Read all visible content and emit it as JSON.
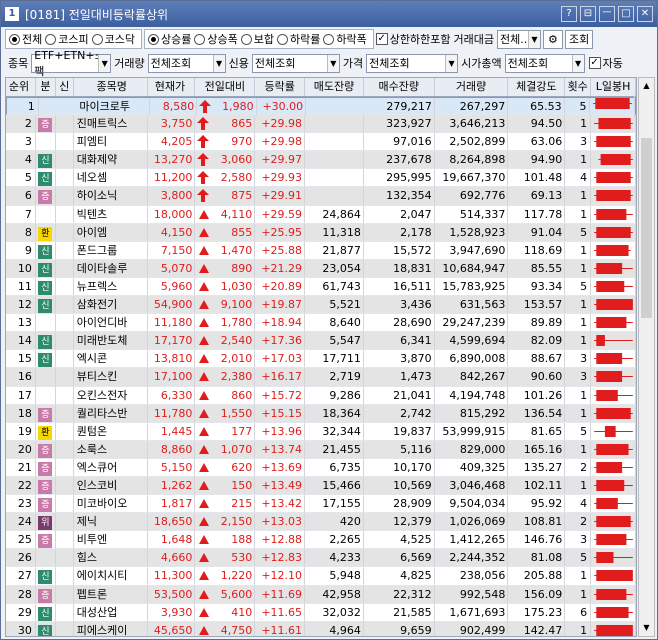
{
  "title": {
    "num": "1",
    "text": "[0181] 전일대비등락률상위"
  },
  "window_buttons": [
    "?",
    "⊟",
    "ㅡ",
    "□",
    "✕"
  ],
  "filters": {
    "market": {
      "options": [
        "전체",
        "코스피",
        "코스닥"
      ],
      "selected": 0
    },
    "type": {
      "options": [
        "상승률",
        "상승폭",
        "보합",
        "하락률",
        "하락폭"
      ],
      "selected": 0
    },
    "upper_limit": {
      "label": "상한하한포함",
      "checked": true
    },
    "amount_label": "거래대금",
    "amount_value": "전체..",
    "search_button": "조회",
    "item_label": "종목",
    "item_value": "ETF+ETN+스팩",
    "volume_label": "거래량",
    "volume_value": "전체조회",
    "credit_label": "신용",
    "credit_value": "전체조회",
    "price_label": "가격",
    "price_value": "전체조회",
    "cap_label": "시가총액",
    "cap_value": "전체조회",
    "auto_label": "자동"
  },
  "columns": [
    "순위",
    "분",
    "신",
    "종목명",
    "현재가",
    "전일대비",
    "등락률",
    "매도잔량",
    "매수잔량",
    "거래량",
    "체결강도",
    "횟수",
    "L일봉H"
  ],
  "colors": {
    "up": "#e01c1c",
    "badge_증": "#c87aa8",
    "badge_신": "#2e8b6e",
    "badge_환": "#f5d800",
    "badge_위": "#7a3a6a"
  },
  "rows": [
    {
      "rank": "1",
      "b": "",
      "s": "",
      "name": "마이크로투",
      "price": "8,580",
      "diff": "1,980",
      "rate": "+30.00",
      "sell": "",
      "buy": "279,217",
      "vol": "267,297",
      "str": "65.53",
      "cnt": "5",
      "mark": "limit",
      "cs": [
        0.05,
        0.95,
        0.1,
        0.9
      ]
    },
    {
      "rank": "2",
      "b": "증",
      "s": "",
      "name": "진매트릭스",
      "price": "3,750",
      "diff": "865",
      "rate": "+29.98",
      "sell": "",
      "buy": "323,927",
      "vol": "3,646,213",
      "str": "94.50",
      "cnt": "1",
      "mark": "limit",
      "cs": [
        0.05,
        0.95,
        0.15,
        0.9
      ]
    },
    {
      "rank": "3",
      "b": "",
      "s": "",
      "name": "피엠티",
      "price": "4,205",
      "diff": "970",
      "rate": "+29.98",
      "sell": "",
      "buy": "97,016",
      "vol": "2,502,899",
      "str": "63.06",
      "cnt": "3",
      "mark": "limit",
      "cs": [
        0.05,
        0.95,
        0.1,
        0.9
      ]
    },
    {
      "rank": "4",
      "b": "신",
      "s": "",
      "name": "대화제약",
      "price": "13,270",
      "diff": "3,060",
      "rate": "+29.97",
      "sell": "",
      "buy": "237,678",
      "vol": "8,264,898",
      "str": "94.90",
      "cnt": "1",
      "mark": "limit",
      "cs": [
        0.15,
        0.95,
        0.2,
        0.9
      ]
    },
    {
      "rank": "5",
      "b": "신",
      "s": "",
      "name": "네오셈",
      "price": "11,200",
      "diff": "2,580",
      "rate": "+29.93",
      "sell": "",
      "buy": "295,995",
      "vol": "19,667,370",
      "str": "101.48",
      "cnt": "4",
      "mark": "limit",
      "cs": [
        0.05,
        0.95,
        0.1,
        0.9
      ]
    },
    {
      "rank": "6",
      "b": "증",
      "s": "",
      "name": "하이소닉",
      "price": "3,800",
      "diff": "875",
      "rate": "+29.91",
      "sell": "",
      "buy": "132,354",
      "vol": "692,776",
      "str": "69.13",
      "cnt": "1",
      "mark": "limit",
      "cs": [
        0.05,
        0.95,
        0.1,
        0.9
      ]
    },
    {
      "rank": "7",
      "b": "",
      "s": "",
      "name": "빅텐츠",
      "price": "18,000",
      "diff": "4,110",
      "rate": "+29.59",
      "sell": "24,864",
      "buy": "2,047",
      "vol": "514,337",
      "str": "117.78",
      "cnt": "1",
      "mark": "up",
      "cs": [
        0.05,
        0.95,
        0.1,
        0.8
      ]
    },
    {
      "rank": "8",
      "b": "환",
      "s": "",
      "name": "아이엠",
      "price": "4,150",
      "diff": "855",
      "rate": "+25.95",
      "sell": "11,318",
      "buy": "2,178",
      "vol": "1,528,923",
      "str": "91.04",
      "cnt": "5",
      "mark": "up",
      "cs": [
        0.05,
        0.95,
        0.1,
        0.9
      ]
    },
    {
      "rank": "9",
      "b": "신",
      "s": "",
      "name": "폰드그룹",
      "price": "7,150",
      "diff": "1,470",
      "rate": "+25.88",
      "sell": "21,877",
      "buy": "15,572",
      "vol": "3,947,690",
      "str": "118.69",
      "cnt": "1",
      "mark": "up",
      "cs": [
        0.05,
        0.9,
        0.1,
        0.85
      ]
    },
    {
      "rank": "10",
      "b": "신",
      "s": "",
      "name": "데이타솔루",
      "price": "5,070",
      "diff": "890",
      "rate": "+21.29",
      "sell": "23,054",
      "buy": "18,831",
      "vol": "10,684,947",
      "str": "85.55",
      "cnt": "1",
      "mark": "up",
      "cs": [
        0.05,
        0.95,
        0.1,
        0.7
      ]
    },
    {
      "rank": "11",
      "b": "신",
      "s": "",
      "name": "뉴프렉스",
      "price": "5,960",
      "diff": "1,030",
      "rate": "+20.89",
      "sell": "61,743",
      "buy": "16,511",
      "vol": "15,783,925",
      "str": "93.34",
      "cnt": "5",
      "mark": "up",
      "cs": [
        0.05,
        0.95,
        0.1,
        0.75
      ]
    },
    {
      "rank": "12",
      "b": "신",
      "s": "",
      "name": "삼화전기",
      "price": "54,900",
      "diff": "9,100",
      "rate": "+19.87",
      "sell": "5,521",
      "buy": "3,436",
      "vol": "631,563",
      "str": "153.57",
      "cnt": "1",
      "mark": "up",
      "cs": [
        0.05,
        0.95,
        0.1,
        0.95
      ]
    },
    {
      "rank": "13",
      "b": "",
      "s": "",
      "name": "아이언디바",
      "price": "11,180",
      "diff": "1,780",
      "rate": "+18.94",
      "sell": "8,640",
      "buy": "28,690",
      "vol": "29,247,239",
      "str": "89.89",
      "cnt": "1",
      "mark": "up",
      "cs": [
        0.05,
        0.95,
        0.1,
        0.8
      ]
    },
    {
      "rank": "14",
      "b": "신",
      "s": "",
      "name": "미래반도체",
      "price": "17,170",
      "diff": "2,540",
      "rate": "+17.36",
      "sell": "5,547",
      "buy": "6,341",
      "vol": "4,599,694",
      "str": "82.09",
      "cnt": "1",
      "mark": "up",
      "cs": [
        0.05,
        0.95,
        0.1,
        0.3
      ]
    },
    {
      "rank": "15",
      "b": "신",
      "s": "",
      "name": "엑시콘",
      "price": "13,810",
      "diff": "2,010",
      "rate": "+17.03",
      "sell": "17,711",
      "buy": "3,870",
      "vol": "6,890,008",
      "str": "88.67",
      "cnt": "3",
      "mark": "up",
      "cs": [
        0.05,
        0.95,
        0.1,
        0.7
      ]
    },
    {
      "rank": "16",
      "b": "",
      "s": "",
      "name": "뷰티스킨",
      "price": "17,100",
      "diff": "2,380",
      "rate": "+16.17",
      "sell": "2,719",
      "buy": "1,473",
      "vol": "842,267",
      "str": "90.60",
      "cnt": "3",
      "mark": "up",
      "cs": [
        0.05,
        0.95,
        0.1,
        0.7
      ]
    },
    {
      "rank": "17",
      "b": "",
      "s": "",
      "name": "오킨스전자",
      "price": "6,330",
      "diff": "860",
      "rate": "+15.72",
      "sell": "9,286",
      "buy": "21,041",
      "vol": "4,194,748",
      "str": "101.26",
      "cnt": "1",
      "mark": "up",
      "cs": [
        0.05,
        0.95,
        0.1,
        0.6
      ]
    },
    {
      "rank": "18",
      "b": "증",
      "s": "",
      "name": "퀄리타스반",
      "price": "11,780",
      "diff": "1,550",
      "rate": "+15.15",
      "sell": "18,364",
      "buy": "2,742",
      "vol": "815,292",
      "str": "136.54",
      "cnt": "1",
      "mark": "up",
      "cs": [
        0.05,
        0.95,
        0.1,
        0.9
      ]
    },
    {
      "rank": "19",
      "b": "환",
      "s": "",
      "name": "퀀텀온",
      "price": "1,445",
      "diff": "177",
      "rate": "+13.96",
      "sell": "32,344",
      "buy": "19,837",
      "vol": "53,999,915",
      "str": "81.65",
      "cnt": "5",
      "mark": "up",
      "cs": [
        0.05,
        0.95,
        0.3,
        0.55
      ]
    },
    {
      "rank": "20",
      "b": "증",
      "s": "",
      "name": "소룩스",
      "price": "8,860",
      "diff": "1,070",
      "rate": "+13.74",
      "sell": "21,455",
      "buy": "5,116",
      "vol": "829,000",
      "str": "165.16",
      "cnt": "1",
      "mark": "up",
      "cs": [
        0.05,
        0.95,
        0.1,
        0.85
      ]
    },
    {
      "rank": "21",
      "b": "증",
      "s": "",
      "name": "엑스큐어",
      "price": "5,150",
      "diff": "620",
      "rate": "+13.69",
      "sell": "6,735",
      "buy": "10,170",
      "vol": "409,325",
      "str": "135.27",
      "cnt": "2",
      "mark": "up",
      "cs": [
        0.05,
        0.95,
        0.1,
        0.7
      ]
    },
    {
      "rank": "22",
      "b": "증",
      "s": "",
      "name": "인스코비",
      "price": "1,262",
      "diff": "150",
      "rate": "+13.49",
      "sell": "15,466",
      "buy": "10,569",
      "vol": "3,046,468",
      "str": "102.11",
      "cnt": "1",
      "mark": "up",
      "cs": [
        0.05,
        0.95,
        0.1,
        0.75
      ]
    },
    {
      "rank": "23",
      "b": "증",
      "s": "",
      "name": "미코바이오",
      "price": "1,817",
      "diff": "215",
      "rate": "+13.42",
      "sell": "17,155",
      "buy": "28,909",
      "vol": "9,504,034",
      "str": "95.92",
      "cnt": "4",
      "mark": "up",
      "cs": [
        0.05,
        0.95,
        0.1,
        0.6
      ]
    },
    {
      "rank": "24",
      "b": "위",
      "s": "",
      "name": "제닉",
      "price": "18,650",
      "diff": "2,150",
      "rate": "+13.03",
      "sell": "420",
      "buy": "12,379",
      "vol": "1,026,069",
      "str": "108.81",
      "cnt": "2",
      "mark": "up",
      "cs": [
        0.05,
        0.95,
        0.1,
        0.9
      ]
    },
    {
      "rank": "25",
      "b": "증",
      "s": "",
      "name": "비투엔",
      "price": "1,648",
      "diff": "188",
      "rate": "+12.88",
      "sell": "2,265",
      "buy": "4,525",
      "vol": "1,412,265",
      "str": "146.76",
      "cnt": "3",
      "mark": "up",
      "cs": [
        0.05,
        0.95,
        0.1,
        0.8
      ]
    },
    {
      "rank": "26",
      "b": "",
      "s": "",
      "name": "힘스",
      "price": "4,660",
      "diff": "530",
      "rate": "+12.83",
      "sell": "4,233",
      "buy": "6,569",
      "vol": "2,244,352",
      "str": "81.08",
      "cnt": "5",
      "mark": "up",
      "cs": [
        0.05,
        0.95,
        0.1,
        0.5
      ]
    },
    {
      "rank": "27",
      "b": "신",
      "s": "",
      "name": "에이치시티",
      "price": "11,300",
      "diff": "1,220",
      "rate": "+12.10",
      "sell": "5,948",
      "buy": "4,825",
      "vol": "238,056",
      "str": "205.88",
      "cnt": "1",
      "mark": "up",
      "cs": [
        0.05,
        0.95,
        0.1,
        0.95
      ]
    },
    {
      "rank": "28",
      "b": "증",
      "s": "",
      "name": "펩트론",
      "price": "53,500",
      "diff": "5,600",
      "rate": "+11.69",
      "sell": "42,958",
      "buy": "22,312",
      "vol": "992,548",
      "str": "156.09",
      "cnt": "1",
      "mark": "up",
      "cs": [
        0.05,
        0.95,
        0.1,
        0.8
      ]
    },
    {
      "rank": "29",
      "b": "신",
      "s": "",
      "name": "대성산업",
      "price": "3,930",
      "diff": "410",
      "rate": "+11.65",
      "sell": "32,032",
      "buy": "21,585",
      "vol": "1,671,693",
      "str": "175.23",
      "cnt": "6",
      "mark": "up",
      "cs": [
        0.05,
        0.95,
        0.1,
        0.85
      ]
    },
    {
      "rank": "30",
      "b": "신",
      "s": "",
      "name": "피에스케이",
      "price": "45,650",
      "diff": "4,750",
      "rate": "+11.61",
      "sell": "4,964",
      "buy": "9,659",
      "vol": "902,499",
      "str": "142.47",
      "cnt": "1",
      "mark": "up",
      "cs": [
        0.05,
        0.95,
        0.1,
        0.95
      ]
    }
  ]
}
